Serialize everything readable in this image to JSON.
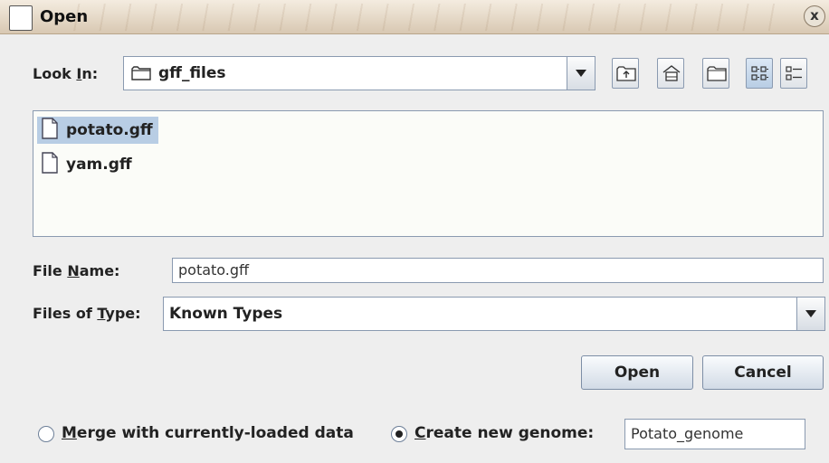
{
  "window": {
    "title": "Open",
    "close_glyph": "x"
  },
  "look_in": {
    "label_pre": "Look ",
    "label_mnemonic": "I",
    "label_post": "n:",
    "value": "gff_files",
    "icon": "folder-icon"
  },
  "toolbar": [
    {
      "name": "up-one-level-button",
      "icon": "up-folder-icon"
    },
    {
      "name": "home-button",
      "icon": "home-icon"
    },
    {
      "name": "new-folder-button",
      "icon": "new-folder-icon"
    },
    {
      "name": "list-view-button",
      "icon": "list-view-icon",
      "active": true
    },
    {
      "name": "details-view-button",
      "icon": "details-view-icon",
      "active": false
    }
  ],
  "files": [
    {
      "name": "potato.gff",
      "selected": true
    },
    {
      "name": "yam.gff",
      "selected": false
    }
  ],
  "file_name": {
    "label_pre": "File ",
    "label_mnemonic": "N",
    "label_post": "ame:",
    "value": "potato.gff"
  },
  "files_of_type": {
    "label_pre": "Files of ",
    "label_mnemonic": "T",
    "label_post": "ype:",
    "value": "Known Types"
  },
  "buttons": {
    "open": "Open",
    "cancel": "Cancel"
  },
  "options": {
    "merge": {
      "mnemonic": "M",
      "rest": "erge with currently-loaded data",
      "checked": false
    },
    "create": {
      "mnemonic": "C",
      "rest": "reate new genome:",
      "checked": true
    },
    "genome_name": "Potato_genome"
  },
  "colors": {
    "selection": "#b8cde4",
    "title_bar": "#d8c8b2"
  }
}
